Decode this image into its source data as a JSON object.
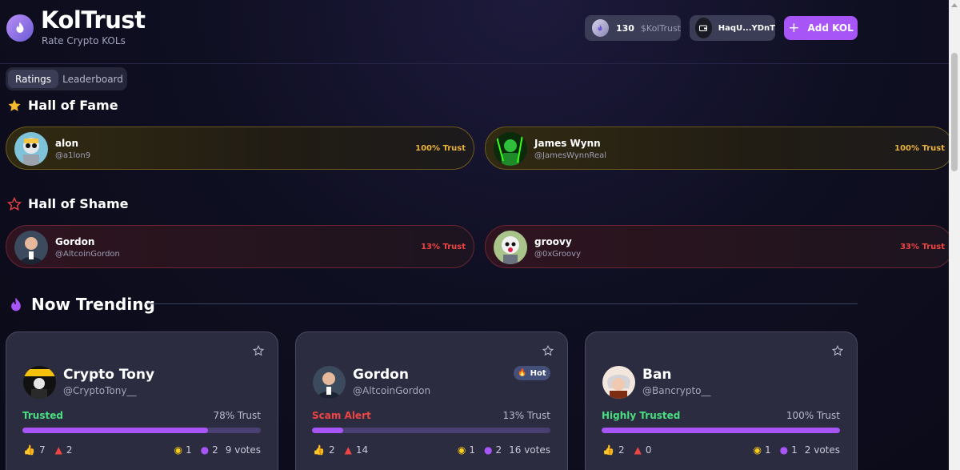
{
  "brand": {
    "title": "KolTrust",
    "subtitle": "Rate Crypto KOLs"
  },
  "header": {
    "token_amount": "130",
    "token_name": "$KolTrust",
    "wallet_address": "HaqU...YDnT",
    "add_kol_label": "Add KOL"
  },
  "tabs": [
    {
      "label": "Ratings",
      "active": true
    },
    {
      "label": "Leaderboard",
      "active": false
    }
  ],
  "hall_of_fame": {
    "title": "Hall of Fame",
    "items": [
      {
        "name": "alon",
        "handle": "@a1lon9",
        "trust": "100% Trust"
      },
      {
        "name": "James Wynn",
        "handle": "@JamesWynnReal",
        "trust": "100% Trust"
      }
    ]
  },
  "hall_of_shame": {
    "title": "Hall of Shame",
    "items": [
      {
        "name": "Gordon",
        "handle": "@AltcoinGordon",
        "trust": "13% Trust"
      },
      {
        "name": "groovy",
        "handle": "@0xGroovy",
        "trust": "33% Trust"
      }
    ]
  },
  "trending": {
    "title": "Now Trending",
    "cards": [
      {
        "name": "Crypto Tony",
        "handle": "@CryptoTony__",
        "badge": "",
        "status": "Trusted",
        "status_color": "#4ade80",
        "trust": "78% Trust",
        "trust_value": 0.78,
        "upvotes": "7",
        "flags": "2",
        "views": "1",
        "comments": "2",
        "votes": "9 votes"
      },
      {
        "name": "Gordon",
        "handle": "@AltcoinGordon",
        "badge": "Hot",
        "status": "Scam Alert",
        "status_color": "#ef4444",
        "trust": "13% Trust",
        "trust_value": 0.13,
        "upvotes": "2",
        "flags": "14",
        "views": "1",
        "comments": "2",
        "votes": "16 votes"
      },
      {
        "name": "Ban",
        "handle": "@Bancrypto__",
        "badge": "",
        "status": "Highly Trusted",
        "status_color": "#4ade80",
        "trust": "100% Trust",
        "trust_value": 1.0,
        "upvotes": "2",
        "flags": "0",
        "views": "1",
        "comments": "1",
        "votes": "2 votes"
      }
    ]
  },
  "colors": {
    "accent": "#a855f7",
    "fame": "#e9b23b",
    "shame": "#ef4444",
    "trusted": "#4ade80"
  },
  "icons": [
    "flame-logo-icon",
    "token-icon",
    "wallet-icon",
    "plus-icon",
    "star-filled-icon",
    "star-outline-icon",
    "flame-icon",
    "thumbs-up-icon",
    "warning-icon",
    "eye-icon",
    "chat-icon"
  ]
}
